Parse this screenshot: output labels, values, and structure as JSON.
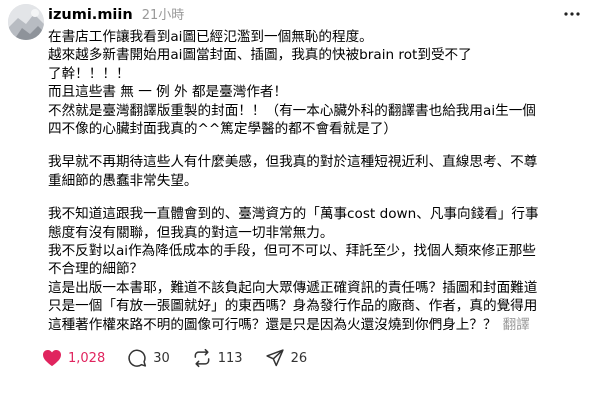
{
  "post": {
    "username": "izumi.miin",
    "time": "21小時",
    "paragraphs": [
      [
        "在書店工作讓我看到ai圖已經氾濫到一個無恥的程度。",
        "越來越多新書開始用ai圖當封面、插圖，我真的快被brain rot到受不了",
        "了幹！！！！",
        "而且這些書 無 一 例 外 都是臺灣作者！",
        "不然就是臺灣翻譯版重製的封面！！（有一本心臟外科的翻譯書也給我用ai生一個",
        "四不像的心臟封面我真的^^篤定學醫的都不會看就是了）"
      ],
      [
        "我早就不再期待這些人有什麼美感，但我真的對於這種短視近利、直線思考、不尊",
        "重細節的愚蠢非常失望。"
      ],
      [
        "我不知道這跟我一直體會到的、臺灣資方的「萬事cost down、凡事向錢看」行事",
        "態度有沒有關聯，但我真的對這一切非常無力。",
        "我不反對以ai作為降低成本的手段，但可不可以、拜託至少，找個人類來修正那些",
        "不合理的細節？",
        "這是出版一本書耶，難道不該負起向大眾傳遞正確資訊的責任嗎？插圖和封面難道",
        "只是一個「有放一張圖就好」的東西嗎？身為發行作品的廠商、作者，真的覺得用",
        "這種著作權來路不明的圖像可行嗎？還是只是因為火還沒燒到你們身上？？"
      ]
    ],
    "translate_label": "翻譯"
  },
  "actions": {
    "like_count": "1,028",
    "comment_count": "30",
    "repost_count": "113",
    "share_count": "26"
  },
  "colors": {
    "like": "#e0245e",
    "muted": "#999999"
  },
  "icons": [
    "avatar",
    "more-icon",
    "heart-icon",
    "comment-icon",
    "repost-icon",
    "share-icon"
  ]
}
